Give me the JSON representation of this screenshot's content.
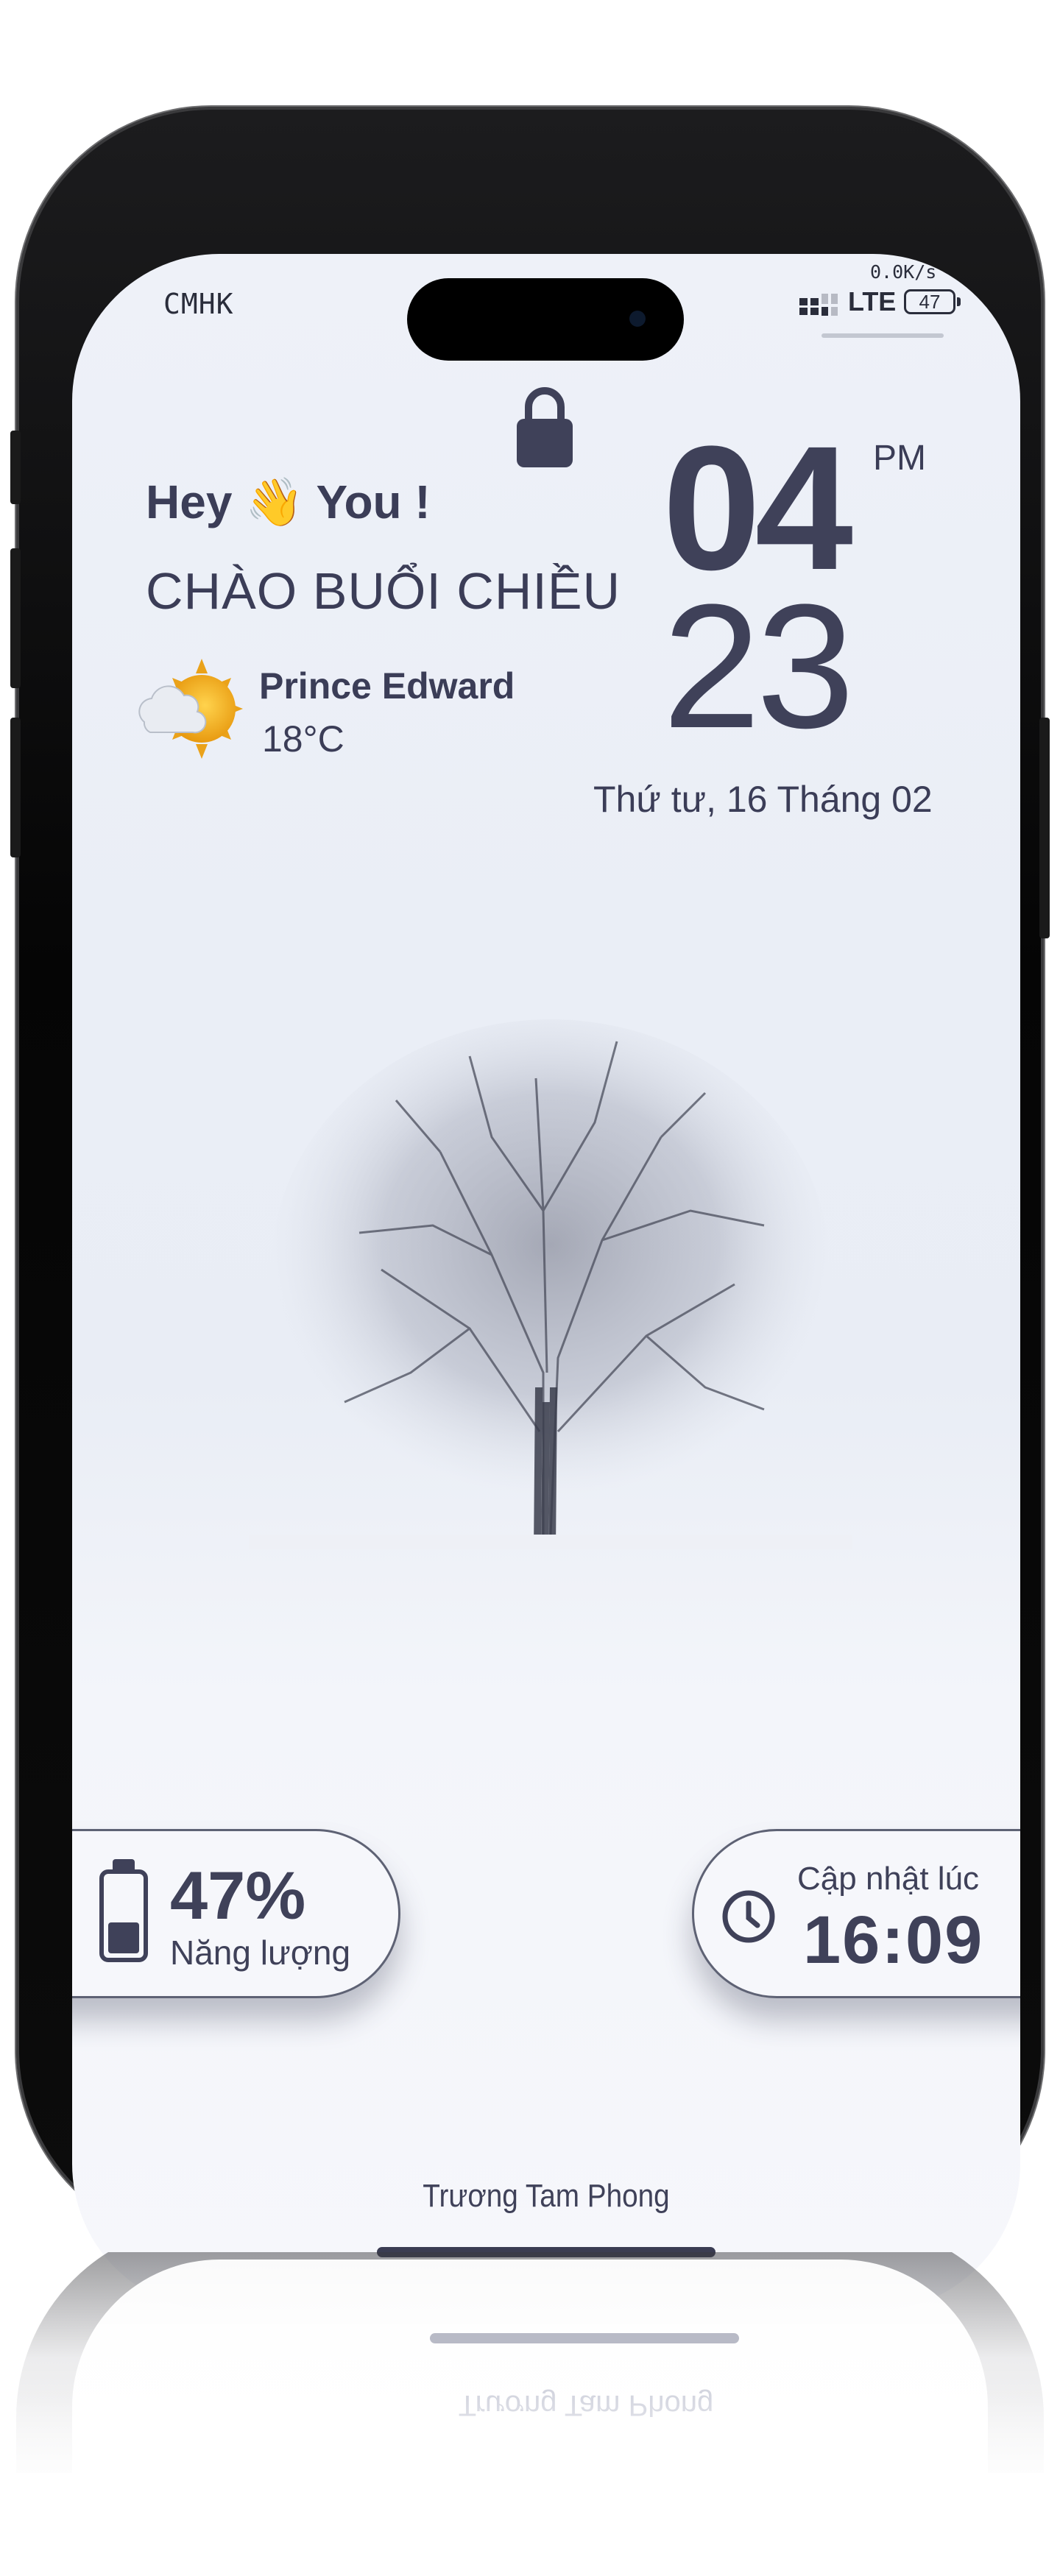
{
  "status_bar": {
    "carrier": "CMHK",
    "network_speed": "0.0K/s",
    "network_type": "LTE",
    "battery_level": "47",
    "signal_icon": "signal-bars-icon"
  },
  "lock_icon": "lock-icon",
  "greeting": {
    "hey": "Hey 👋 You !",
    "subtitle": "CHÀO BUỔI CHIỀU"
  },
  "weather": {
    "icon": "partly-cloudy-icon",
    "location": "Prince Edward",
    "temperature": "18°C"
  },
  "clock": {
    "hour": "04",
    "minute": "23",
    "ampm": "PM",
    "date": "Thứ tư, 16 Tháng 02"
  },
  "widgets": {
    "battery": {
      "icon": "battery-icon",
      "percent": "47%",
      "percent_value": 0.47,
      "label": "Năng lượng"
    },
    "update": {
      "icon": "clock-icon",
      "label": "Cập nhật lúc",
      "time": "16:09"
    }
  },
  "author": "Trương Tam Phong",
  "colors": {
    "accent": "#3f4159",
    "background": "#eef1f8",
    "frame": "#0c0c0c"
  }
}
